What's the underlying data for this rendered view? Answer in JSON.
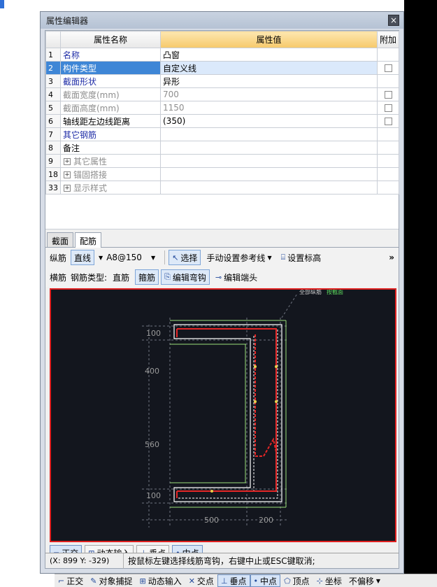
{
  "window": {
    "title": "属性编辑器",
    "close": "×"
  },
  "table": {
    "headers": {
      "name": "属性名称",
      "value": "属性值",
      "extra": "附加"
    },
    "rows": [
      {
        "num": "1",
        "name": "名称",
        "value": "凸窗",
        "checkbox": false
      },
      {
        "num": "2",
        "name": "构件类型",
        "value": "自定义线",
        "checkbox": true
      },
      {
        "num": "3",
        "name": "截面形状",
        "value": "异形",
        "checkbox": false
      },
      {
        "num": "4",
        "name": "截面宽度(mm)",
        "value": "700",
        "checkbox": true
      },
      {
        "num": "5",
        "name": "截面高度(mm)",
        "value": "1150",
        "checkbox": true
      },
      {
        "num": "6",
        "name": "轴线距左边线距离",
        "value": "(350)",
        "checkbox": true
      },
      {
        "num": "7",
        "name": "其它钢筋",
        "value": "",
        "checkbox": false
      },
      {
        "num": "8",
        "name": "备注",
        "value": "",
        "checkbox": false
      },
      {
        "num": "9",
        "name": "其它属性",
        "value": "",
        "checkbox": false
      },
      {
        "num": "18",
        "name": "锚固搭接",
        "value": "",
        "checkbox": false
      },
      {
        "num": "33",
        "name": "显示样式",
        "value": "",
        "checkbox": false
      }
    ]
  },
  "tabs": {
    "section": "截面",
    "rebar": "配筋"
  },
  "toolbar1": {
    "label": "纵筋",
    "line": "直线",
    "spec": "A8@150",
    "select": "选择",
    "manual_ref": "手动设置参考线",
    "set_mark": "设置标高",
    "more": "»"
  },
  "toolbar2": {
    "label": "横筋",
    "rebar_type_label": "钢筋类型:",
    "straight": "直筋",
    "stirrup": "箍筋",
    "edit_hook": "编辑弯钩",
    "edit_end": "编辑端头"
  },
  "canvas": {
    "legend_all": "全部纵筋",
    "legend_hint": "按截面",
    "dims": {
      "top_h": "100",
      "mid_h": "400",
      "low_h": "560",
      "bot_h": "100",
      "left_w": "500",
      "right_w": "200"
    }
  },
  "snap": {
    "ortho": "正交",
    "dynamic": "动态输入",
    "perp": "垂点",
    "mid": "中点"
  },
  "status": {
    "coord": "(X: 899 Y: -329)",
    "hint": "按鼠标左键选择线筋弯钩，右键中止或ESC键取消;"
  },
  "bottombar": {
    "ortho": "正交",
    "object_snap": "对象捕捉",
    "dynamic": "动态输入",
    "intersect": "交点",
    "perp": "垂点",
    "mid": "中点",
    "vertex": "顶点",
    "coord": "坐标",
    "offset": "不偏移"
  }
}
